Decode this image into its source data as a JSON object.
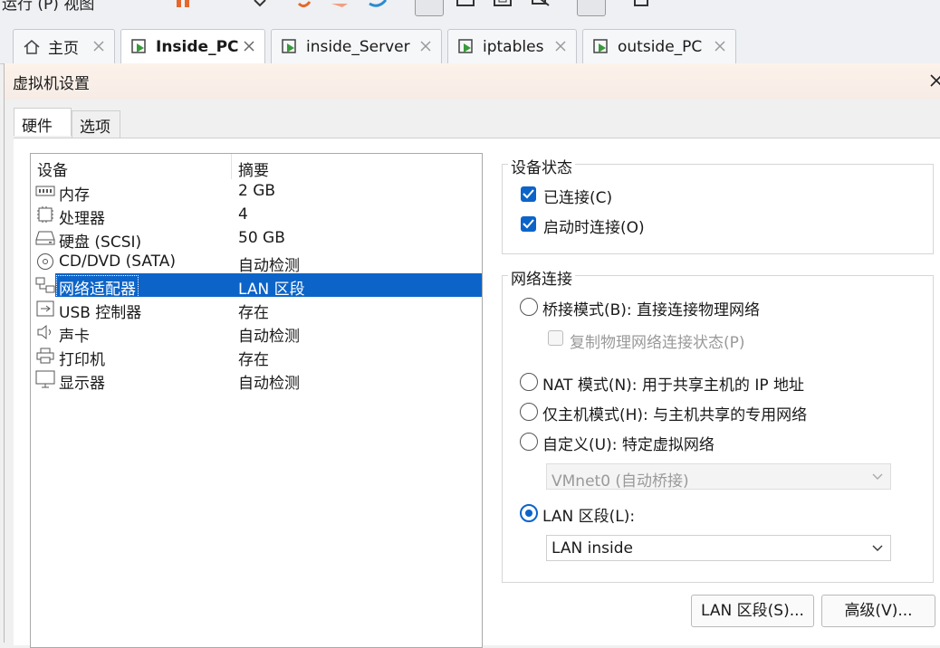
{
  "toolbar": {
    "menu_text": "运行 (P) 视图"
  },
  "tabs": [
    {
      "label": "主页",
      "icon": "home-icon"
    },
    {
      "label": "Inside_PC",
      "icon": "vm-icon"
    },
    {
      "label": "inside_Server",
      "icon": "vm-icon"
    },
    {
      "label": "iptables",
      "icon": "vm-icon"
    },
    {
      "label": "outside_PC",
      "icon": "vm-icon"
    }
  ],
  "dialog": {
    "title": "虚拟机设置",
    "tabs": [
      "硬件",
      "选项"
    ],
    "device_list": {
      "headers": [
        "设备",
        "摘要"
      ],
      "rows": [
        {
          "name": "内存",
          "summary": "2 GB",
          "icon": "memory-icon"
        },
        {
          "name": "处理器",
          "summary": "4",
          "icon": "cpu-icon"
        },
        {
          "name": "硬盘 (SCSI)",
          "summary": "50 GB",
          "icon": "harddisk-icon"
        },
        {
          "name": "CD/DVD (SATA)",
          "summary": "自动检测",
          "icon": "cd-icon"
        },
        {
          "name": "网络适配器",
          "summary": "LAN 区段",
          "icon": "network-icon",
          "selected": true
        },
        {
          "name": "USB 控制器",
          "summary": "存在",
          "icon": "usb-icon"
        },
        {
          "name": "声卡",
          "summary": "自动检测",
          "icon": "speaker-icon"
        },
        {
          "name": "打印机",
          "summary": "存在",
          "icon": "printer-icon"
        },
        {
          "name": "显示器",
          "summary": "自动检测",
          "icon": "monitor-icon"
        }
      ]
    },
    "device_status": {
      "title": "设备状态",
      "connected": {
        "label": "已连接(C)",
        "checked": true
      },
      "connect_at_power_on": {
        "label": "启动时连接(O)",
        "checked": true
      }
    },
    "network": {
      "title": "网络连接",
      "bridged": {
        "label": "桥接模式(B): 直接连接物理网络",
        "selected": false
      },
      "replicate": {
        "label": "复制物理网络连接状态(P)",
        "checked": false
      },
      "nat": {
        "label": "NAT 模式(N): 用于共享主机的 IP 地址",
        "selected": false
      },
      "hostonly": {
        "label": "仅主机模式(H): 与主机共享的专用网络",
        "selected": false
      },
      "custom": {
        "label": "自定义(U): 特定虚拟网络",
        "selected": false
      },
      "custom_select": "VMnet0 (自动桥接)",
      "lan": {
        "label": "LAN 区段(L):",
        "selected": true
      },
      "lan_select": "LAN inside"
    },
    "buttons": {
      "lan_segments": "LAN 区段(S)...",
      "advanced": "高级(V)..."
    }
  },
  "colors": {
    "accent": "#0c64c8",
    "vm_icon_green": "#3a9a3a",
    "toolbar_orange": "#e5672b"
  }
}
